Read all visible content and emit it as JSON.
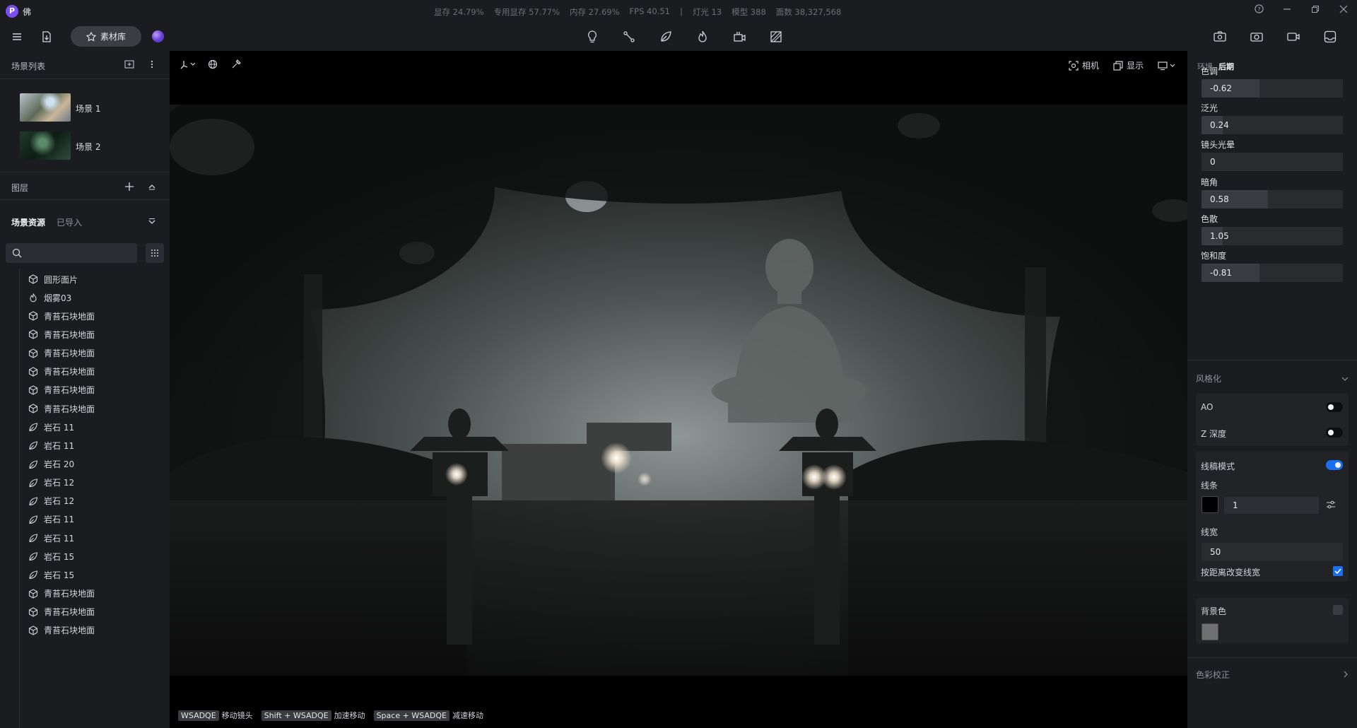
{
  "app": {
    "logo_letter": "P",
    "title": "佛"
  },
  "stats": [
    "显存 24.79%",
    "专用显存 57.77%",
    "内存 27.69%",
    "FPS 40.51",
    "|",
    "灯光 13",
    "模型 388",
    "面数 38,327,568"
  ],
  "toolbar": {
    "library_label": "素材库"
  },
  "left": {
    "scene_list_title": "场景列表",
    "scenes": [
      {
        "name": "场景 1"
      },
      {
        "name": "场景 2"
      }
    ],
    "layers_title": "图层",
    "assets_tab_active": "场景资源",
    "assets_tab_other": "已导入",
    "search_placeholder": "",
    "tree": [
      {
        "icon": "cube-icon",
        "label": "圆形面片"
      },
      {
        "icon": "fire-icon",
        "label": "烟雾03"
      },
      {
        "icon": "cube-icon",
        "label": "青苔石块地面"
      },
      {
        "icon": "cube-icon",
        "label": "青苔石块地面"
      },
      {
        "icon": "cube-icon",
        "label": "青苔石块地面"
      },
      {
        "icon": "cube-icon",
        "label": "青苔石块地面"
      },
      {
        "icon": "cube-icon",
        "label": "青苔石块地面"
      },
      {
        "icon": "cube-icon",
        "label": "青苔石块地面"
      },
      {
        "icon": "leaf-icon",
        "label": "岩石 11"
      },
      {
        "icon": "leaf-icon",
        "label": "岩石 11"
      },
      {
        "icon": "leaf-icon",
        "label": "岩石 20"
      },
      {
        "icon": "leaf-icon",
        "label": "岩石 12"
      },
      {
        "icon": "leaf-icon",
        "label": "岩石 12"
      },
      {
        "icon": "leaf-icon",
        "label": "岩石 11"
      },
      {
        "icon": "leaf-icon",
        "label": "岩石 11"
      },
      {
        "icon": "leaf-icon",
        "label": "岩石 15"
      },
      {
        "icon": "leaf-icon",
        "label": "岩石 15"
      },
      {
        "icon": "cube-icon",
        "label": "青苔石块地面"
      },
      {
        "icon": "cube-icon",
        "label": "青苔石块地面"
      },
      {
        "icon": "cube-icon",
        "label": "青苔石块地面"
      }
    ]
  },
  "viewport": {
    "camera_label": "相机",
    "display_label": "显示",
    "hints": [
      {
        "key": "WSADQE",
        "text": "移动镜头"
      },
      {
        "key": "Shift + WSADQE",
        "text": "加速移动"
      },
      {
        "key": "Space + WSADQE",
        "text": "减速移动"
      }
    ]
  },
  "right": {
    "tab_env": "环境",
    "tab_post": "后期",
    "props": [
      {
        "label": "色调",
        "value": "-0.62",
        "fill": 0.41
      },
      {
        "label": "泛光",
        "value": "0.24",
        "fill": 0.15
      },
      {
        "label": "镜头光晕",
        "value": "0",
        "fill": 0
      },
      {
        "label": "暗角",
        "value": "0.58",
        "fill": 0.47
      },
      {
        "label": "色散",
        "value": "1.05",
        "fill": 0.15
      },
      {
        "label": "饱和度",
        "value": "-0.81",
        "fill": 0.41
      }
    ],
    "stylize_title": "风格化",
    "ao_label": "AO",
    "ao_on": false,
    "zdepth_label": "Z 深度",
    "zdepth_on": false,
    "wireframe_label": "线稿模式",
    "wireframe_on": true,
    "line_label": "线条",
    "line_value": "1",
    "line_color": "#000000",
    "linewidth_label": "线宽",
    "linewidth_value": "50",
    "distance_label": "按距离改变线宽",
    "distance_checked": true,
    "bg_label": "背景色",
    "bg_checked": false,
    "bg_color": "#707070",
    "color_correct_title": "色彩校正"
  },
  "colors": {
    "accent": "#1a6ff0",
    "panel": "#1b1c20"
  }
}
